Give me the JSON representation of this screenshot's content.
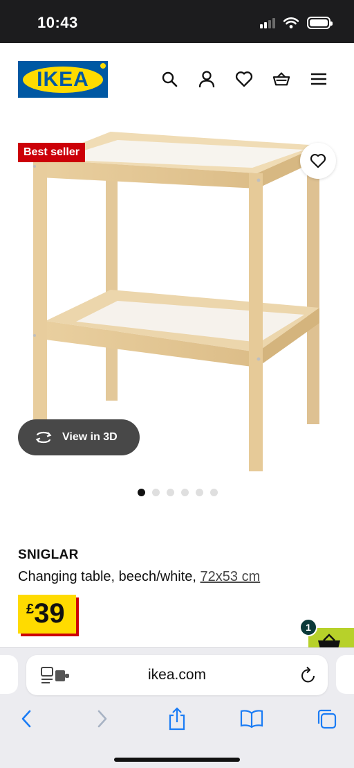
{
  "status_bar": {
    "time": "10:43"
  },
  "header": {
    "logo_text": "IKEA",
    "icons": [
      "search-icon",
      "account-icon",
      "heart-icon",
      "basket-icon",
      "menu-icon"
    ]
  },
  "product": {
    "badge": "Best seller",
    "view_3d_label": "View in 3D",
    "image_count": 6,
    "active_image_index": 0,
    "name": "SNIGLAR",
    "description": "Changing table, beech/white, ",
    "dimensions": "72x53 cm",
    "price_currency": "£",
    "price_amount": "39"
  },
  "cart": {
    "badge_count": "1"
  },
  "browser": {
    "url": "ikea.com"
  },
  "colors": {
    "ikea_blue": "#0058a3",
    "ikea_yellow": "#ffdb00",
    "badge_red": "#cc0008",
    "cart_green": "#b7d12a"
  }
}
